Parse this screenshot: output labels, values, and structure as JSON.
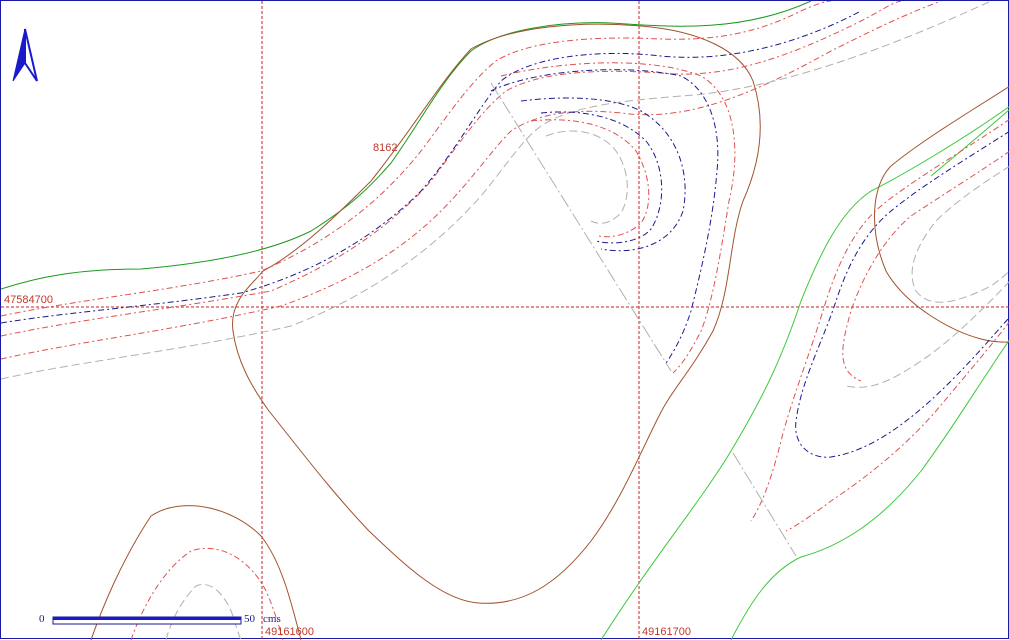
{
  "map": {
    "parcel_label": "8162",
    "grid_labels": {
      "northing": "47584700",
      "easting_left": "49161600",
      "easting_right": "49161700"
    },
    "scale_bar": {
      "start_label": "0",
      "end_label": "50",
      "unit_label": "cms"
    },
    "north_arrow_icon": "north-arrow-icon",
    "colors": {
      "frame": "#1a1aa0",
      "grid": "#cc2222",
      "parcel_boundary": "#a0522d",
      "green_contour": "#1a9a1a",
      "light_green_contour": "#3cc83c",
      "blue_contour": "#1a1a8c",
      "red_contour": "#e05050",
      "gray_contour": "#b0b0b0"
    }
  }
}
